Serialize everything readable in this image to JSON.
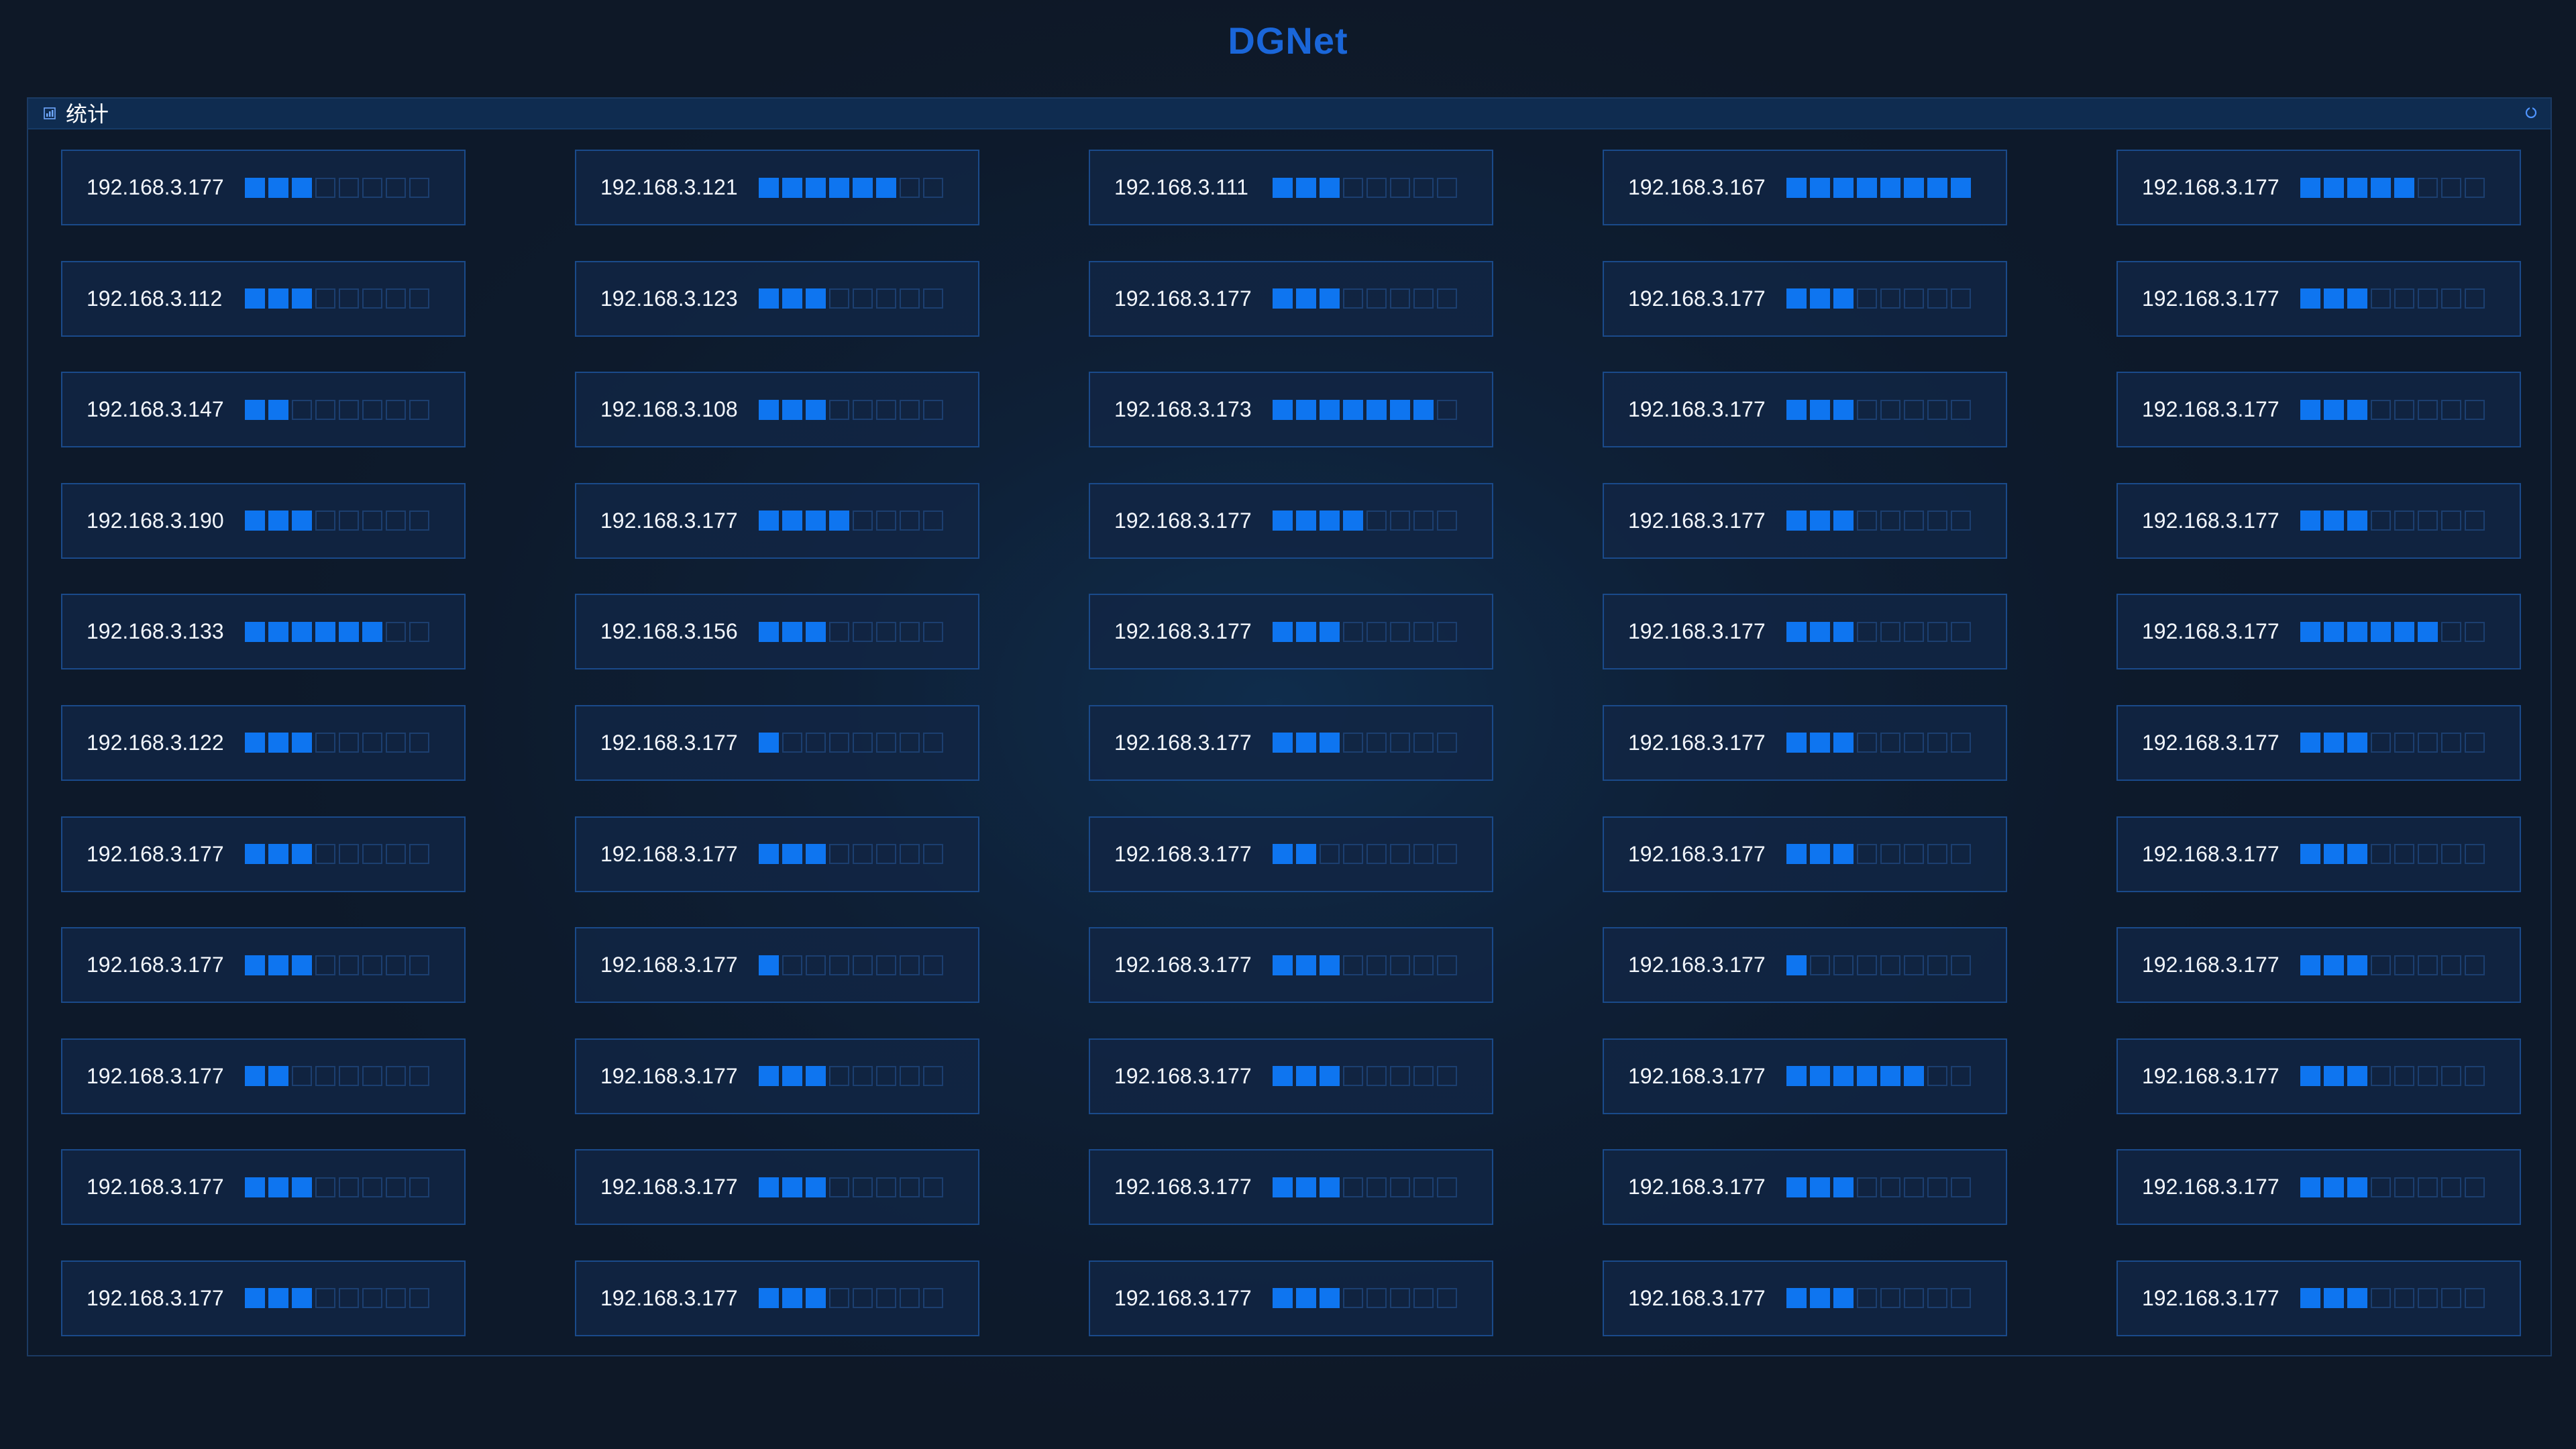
{
  "app": {
    "title": "DGNet"
  },
  "panel": {
    "title": "统计"
  },
  "colors": {
    "accent": "#0e75f0",
    "title": "#1a66d9",
    "cell_off_border": "#1c3f70",
    "card_border": "#1a4a8a"
  },
  "icons": {
    "panel_icon": "chart-icon",
    "refresh_icon": "refresh-icon"
  },
  "levels_total": 8,
  "devices": [
    [
      {
        "ip": "192.168.3.177",
        "level": 3
      },
      {
        "ip": "192.168.3.112",
        "level": 3
      },
      {
        "ip": "192.168.3.147",
        "level": 2
      },
      {
        "ip": "192.168.3.190",
        "level": 3
      },
      {
        "ip": "192.168.3.133",
        "level": 6
      },
      {
        "ip": "192.168.3.122",
        "level": 3
      },
      {
        "ip": "192.168.3.177",
        "level": 3
      },
      {
        "ip": "192.168.3.177",
        "level": 3
      },
      {
        "ip": "192.168.3.177",
        "level": 2
      },
      {
        "ip": "192.168.3.177",
        "level": 3
      },
      {
        "ip": "192.168.3.177",
        "level": 3
      }
    ],
    [
      {
        "ip": "192.168.3.121",
        "level": 6
      },
      {
        "ip": "192.168.3.123",
        "level": 3
      },
      {
        "ip": "192.168.3.108",
        "level": 3
      },
      {
        "ip": "192.168.3.177",
        "level": 4
      },
      {
        "ip": "192.168.3.156",
        "level": 3
      },
      {
        "ip": "192.168.3.177",
        "level": 1
      },
      {
        "ip": "192.168.3.177",
        "level": 3
      },
      {
        "ip": "192.168.3.177",
        "level": 1
      },
      {
        "ip": "192.168.3.177",
        "level": 3
      },
      {
        "ip": "192.168.3.177",
        "level": 3
      },
      {
        "ip": "192.168.3.177",
        "level": 3
      }
    ],
    [
      {
        "ip": "192.168.3.111",
        "level": 3
      },
      {
        "ip": "192.168.3.177",
        "level": 3
      },
      {
        "ip": "192.168.3.173",
        "level": 7
      },
      {
        "ip": "192.168.3.177",
        "level": 4
      },
      {
        "ip": "192.168.3.177",
        "level": 3
      },
      {
        "ip": "192.168.3.177",
        "level": 3
      },
      {
        "ip": "192.168.3.177",
        "level": 2
      },
      {
        "ip": "192.168.3.177",
        "level": 3
      },
      {
        "ip": "192.168.3.177",
        "level": 3
      },
      {
        "ip": "192.168.3.177",
        "level": 3
      },
      {
        "ip": "192.168.3.177",
        "level": 3
      }
    ],
    [
      {
        "ip": "192.168.3.167",
        "level": 8
      },
      {
        "ip": "192.168.3.177",
        "level": 3
      },
      {
        "ip": "192.168.3.177",
        "level": 3
      },
      {
        "ip": "192.168.3.177",
        "level": 3
      },
      {
        "ip": "192.168.3.177",
        "level": 3
      },
      {
        "ip": "192.168.3.177",
        "level": 3
      },
      {
        "ip": "192.168.3.177",
        "level": 3
      },
      {
        "ip": "192.168.3.177",
        "level": 1
      },
      {
        "ip": "192.168.3.177",
        "level": 6
      },
      {
        "ip": "192.168.3.177",
        "level": 3
      },
      {
        "ip": "192.168.3.177",
        "level": 3
      }
    ],
    [
      {
        "ip": "192.168.3.177",
        "level": 5
      },
      {
        "ip": "192.168.3.177",
        "level": 3
      },
      {
        "ip": "192.168.3.177",
        "level": 3
      },
      {
        "ip": "192.168.3.177",
        "level": 3
      },
      {
        "ip": "192.168.3.177",
        "level": 6
      },
      {
        "ip": "192.168.3.177",
        "level": 3
      },
      {
        "ip": "192.168.3.177",
        "level": 3
      },
      {
        "ip": "192.168.3.177",
        "level": 3
      },
      {
        "ip": "192.168.3.177",
        "level": 3
      },
      {
        "ip": "192.168.3.177",
        "level": 3
      },
      {
        "ip": "192.168.3.177",
        "level": 3
      }
    ]
  ]
}
